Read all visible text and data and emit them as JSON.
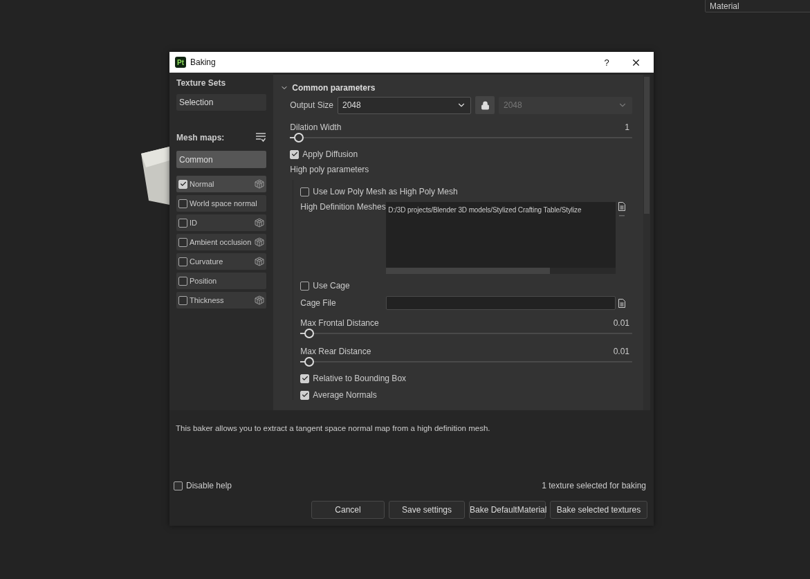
{
  "viewport": {
    "material_dropdown": {
      "value": "Material"
    }
  },
  "dialog": {
    "app_badge": "Pt",
    "title": "Baking",
    "help_button": "?",
    "sidebar": {
      "texture_sets_title": "Texture Sets",
      "texture_set": "Selection",
      "mesh_maps_title": "Mesh maps:",
      "group": {
        "label": "Common",
        "selected": false
      },
      "mesh_maps": [
        {
          "label": "Normal",
          "checked": true,
          "selected": true,
          "has_icon": true
        },
        {
          "label": "World space normal",
          "checked": false,
          "selected": false,
          "has_icon": false
        },
        {
          "label": "ID",
          "checked": false,
          "selected": false,
          "has_icon": true
        },
        {
          "label": "Ambient occlusion",
          "checked": false,
          "selected": false,
          "has_icon": true
        },
        {
          "label": "Curvature",
          "checked": false,
          "selected": false,
          "has_icon": true
        },
        {
          "label": "Position",
          "checked": false,
          "selected": false,
          "has_icon": false
        },
        {
          "label": "Thickness",
          "checked": false,
          "selected": false,
          "has_icon": true
        }
      ]
    },
    "section": {
      "title": "Common parameters",
      "expanded": true,
      "rows": [
        {
          "kind": "size",
          "label": "Output Size",
          "value": "2048",
          "linked_value": "2048"
        },
        {
          "kind": "slider",
          "label": "Dilation Width",
          "reading": "1",
          "level": 0.02
        },
        {
          "kind": "checkbox",
          "label": "Apply Diffusion",
          "checked": true
        },
        {
          "kind": "group",
          "label": "High poly parameters",
          "children": [
            {
              "kind": "checkbox",
              "label": "Use Low Poly Mesh as High Poly Mesh",
              "checked": false
            },
            {
              "kind": "files",
              "label": "High Definition Meshes",
              "value": "D:/3D projects/Blender 3D models/Stylized Crafting Table/Stylize"
            },
            {
              "kind": "checkbox",
              "label": "Use Cage",
              "checked": false
            },
            {
              "kind": "file",
              "label": "Cage File"
            },
            {
              "kind": "slider",
              "label": "Max Frontal Distance",
              "reading": "0.01",
              "level": 0.02
            },
            {
              "kind": "slider",
              "label": "Max Rear Distance",
              "reading": "0.01",
              "level": 0.02
            },
            {
              "kind": "checkbox",
              "label": "Relative to Bounding Box",
              "checked": true
            },
            {
              "kind": "checkbox",
              "label": "Average Normals",
              "checked": true
            }
          ]
        }
      ]
    },
    "help_text": "This baker allows you to extract a tangent space normal map from a high definition mesh.",
    "disable_help": {
      "label": "Disable help",
      "checked": false
    },
    "status": "1 texture selected for baking",
    "buttons": [
      "Cancel",
      "Save settings",
      "Bake DefaultMaterial",
      "Bake selected textures"
    ]
  }
}
